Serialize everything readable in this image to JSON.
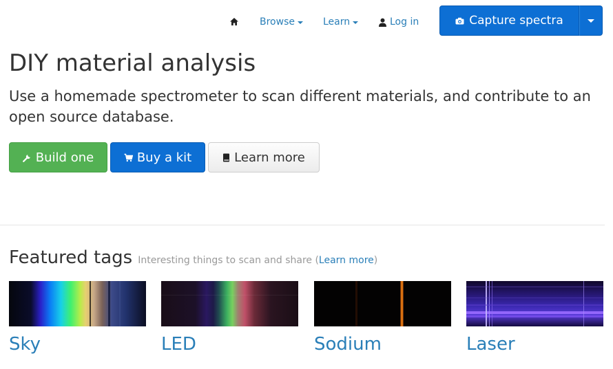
{
  "nav": {
    "home_icon": "home-icon",
    "browse_label": "Browse",
    "learn_label": "Learn",
    "login_label": "Log in",
    "login_icon": "user-icon",
    "capture_label": "Capture spectra",
    "capture_icon": "camera-icon"
  },
  "hero": {
    "title": "DIY material analysis",
    "subtitle": "Use a homemade spectrometer to scan different materials, and contribute to an open source database.",
    "buttons": {
      "build_label": "Build one",
      "build_icon": "wrench-icon",
      "buy_label": "Buy a kit",
      "buy_icon": "cart-icon",
      "learn_label": "Learn more",
      "learn_icon": "book-icon"
    }
  },
  "featured": {
    "title": "Featured tags",
    "subtitle_prefix": "Interesting things to scan and share (",
    "subtitle_link": "Learn more",
    "subtitle_suffix": ")",
    "tags": [
      {
        "label": "Sky"
      },
      {
        "label": "LED"
      },
      {
        "label": "Sodium"
      },
      {
        "label": "Laser"
      }
    ]
  },
  "colors": {
    "primary": "#0d6fd4",
    "success": "#53b153",
    "link": "#2a7fb8"
  }
}
